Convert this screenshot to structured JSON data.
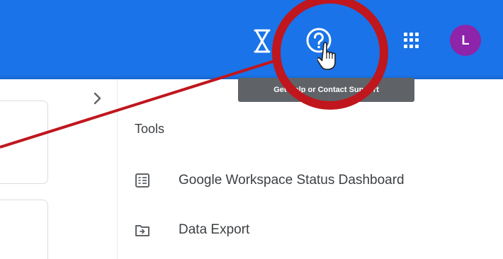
{
  "header": {
    "color": "#1a73e8",
    "hourglass_icon": "hourglass-icon",
    "help_icon": "help-circle-icon",
    "apps_icon": "apps-grid-icon",
    "avatar_letter": "L",
    "avatar_color": "#8e24aa"
  },
  "tooltip": {
    "text": "Get Help or Contact Support"
  },
  "panel": {
    "collapse_icon": "chevron-right-icon",
    "section_title": "Tools",
    "items": [
      {
        "icon": "dashboard-icon",
        "label": "Google Workspace Status Dashboard"
      },
      {
        "icon": "folder-export-icon",
        "label": "Data Export"
      }
    ]
  },
  "annotation": {
    "shape": "circle-with-pointer-line",
    "color": "#c0161d"
  }
}
